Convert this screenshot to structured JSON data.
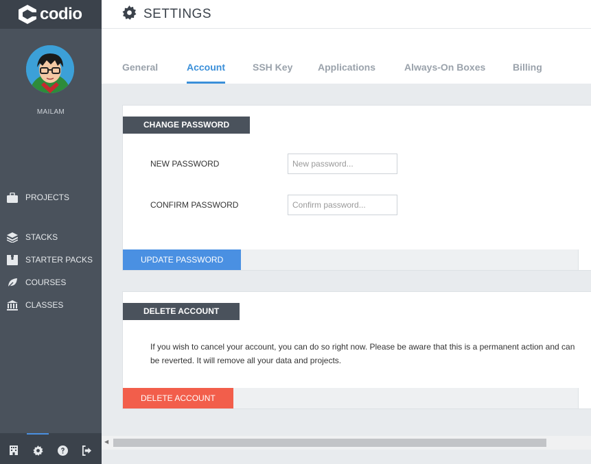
{
  "app": {
    "logo_text": "codio"
  },
  "header": {
    "title": "SETTINGS",
    "icon": "gear-icon"
  },
  "user": {
    "name": "MAILAM"
  },
  "sidebar": {
    "items": [
      {
        "label": "PROJECTS",
        "icon": "briefcase-icon"
      },
      {
        "label": "STACKS",
        "icon": "layers-icon"
      },
      {
        "label": "STARTER PACKS",
        "icon": "box-icon"
      },
      {
        "label": "COURSES",
        "icon": "leaf-icon"
      },
      {
        "label": "CLASSES",
        "icon": "building-icon"
      }
    ],
    "bottom_icons": [
      "office-icon",
      "gear-icon",
      "help-icon",
      "logout-icon"
    ]
  },
  "tabs": [
    {
      "label": "General",
      "active": false
    },
    {
      "label": "Account",
      "active": true
    },
    {
      "label": "SSH Key",
      "active": false
    },
    {
      "label": "Applications",
      "active": false
    },
    {
      "label": "Always-On Boxes",
      "active": false
    },
    {
      "label": "Billing",
      "active": false
    }
  ],
  "change_password": {
    "title": "CHANGE PASSWORD",
    "new_label": "NEW PASSWORD",
    "new_placeholder": "New password...",
    "new_value": "",
    "confirm_label": "CONFIRM PASSWORD",
    "confirm_placeholder": "Confirm password...",
    "confirm_value": "",
    "button": "UPDATE PASSWORD"
  },
  "delete_account": {
    "title": "DELETE ACCOUNT",
    "line1": "If you wish to cancel your account, you can do so right now. Please be aware that this is a permanent action and can",
    "line2": "be reverted. It will remove all your data and projects.",
    "button": "DELETE ACCOUNT"
  },
  "colors": {
    "sidebar": "#4a525c",
    "accent": "#3a8fd9",
    "primary_button": "#4a90e2",
    "danger_button": "#f25e4b"
  }
}
